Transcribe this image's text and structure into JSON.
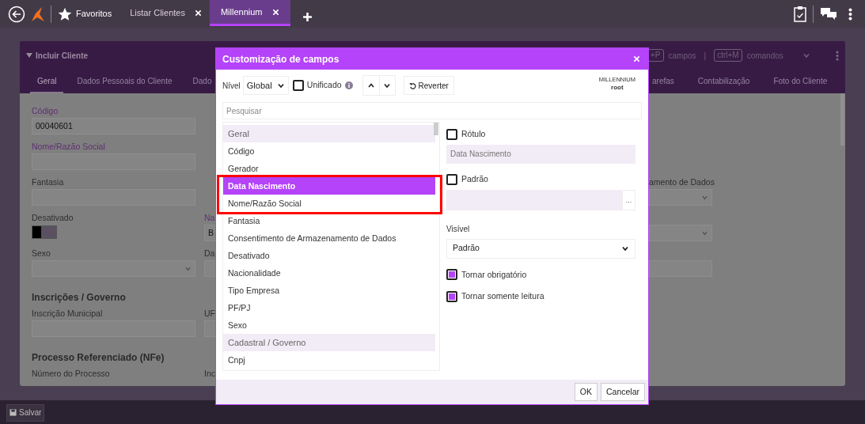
{
  "top_bar": {
    "favorites": "Favoritos",
    "tabs": [
      {
        "label": "Listar Clientes",
        "selected": false
      },
      {
        "label": "Millennium",
        "selected": true
      }
    ]
  },
  "form": {
    "title": "Incluir Cliente",
    "shortcuts": [
      {
        "key": "+P",
        "text": "campos"
      },
      {
        "key": "ctrl+M",
        "text": "comandos"
      }
    ],
    "separator": "|",
    "tabs": [
      {
        "label": "Geral",
        "selected": true
      },
      {
        "label": "Dados Pessoais do Cliente",
        "selected": false
      },
      {
        "label": "Dado",
        "selected": false
      }
    ],
    "tabs_right": [
      {
        "label": "arefas",
        "selected": false
      },
      {
        "label": "Contabilização",
        "selected": false
      },
      {
        "label": "Foto do Cliente",
        "selected": false
      }
    ],
    "rows": [
      {
        "left": {
          "kind": "field",
          "label": "Código",
          "required": true,
          "value": "00040601"
        }
      },
      {
        "left": {
          "kind": "field",
          "label": "Nome/Razão Social",
          "required": true
        }
      },
      {
        "left": {
          "kind": "field",
          "label": "Fantasia",
          "required": false
        },
        "right": {
          "kind": "select",
          "label": "amento de Dados",
          "required": false
        }
      },
      {
        "left": {
          "kind": "toggle",
          "label": "Desativado",
          "required": false,
          "on": false
        },
        "middle": {
          "kind": "field",
          "label": "Na",
          "required": true,
          "value": "B"
        },
        "right": {
          "kind": "select"
        }
      },
      {
        "left": {
          "kind": "select",
          "label": "Sexo",
          "required": false
        },
        "middle": {
          "kind": "field",
          "label": "Da",
          "required": false
        },
        "right": {
          "kind": "field"
        }
      },
      {
        "heading": "Inscrições / Governo"
      },
      {
        "left": {
          "kind": "field",
          "label": "Inscrição Municipal",
          "required": false
        },
        "middle": {
          "kind": "field",
          "label": "UF",
          "required": false
        }
      },
      {
        "heading": "Processo Referenciado (NFe)"
      },
      {
        "left": {
          "kind": "label",
          "label": "Número do Processo",
          "required": false
        },
        "middle": {
          "kind": "label",
          "label": "Inc",
          "required": false
        }
      }
    ]
  },
  "save_button": "Salvar",
  "dialog": {
    "title": "Customização de campos",
    "level_label": "Nível",
    "level_value": "Global",
    "unified": {
      "label": "Unificado",
      "checked": false
    },
    "revert": "Reverter",
    "system": "MILLENNIUM",
    "user": "root",
    "search_placeholder": "Pesquisar",
    "fields": [
      {
        "label": "Geral",
        "kind": "group",
        "selected": false,
        "highlighted": false
      },
      {
        "label": "Código",
        "kind": "item",
        "selected": false,
        "highlighted": false
      },
      {
        "label": "Gerador",
        "kind": "item",
        "selected": false,
        "highlighted": false
      },
      {
        "label": "Data Nascimento",
        "kind": "item",
        "selected": true,
        "highlighted": true
      },
      {
        "label": "Nome/Razão Social",
        "kind": "item",
        "selected": false,
        "highlighted": true
      },
      {
        "label": "Fantasia",
        "kind": "item",
        "selected": false,
        "highlighted": false
      },
      {
        "label": "Consentimento de Armazenamento de Dados",
        "kind": "item",
        "selected": false,
        "highlighted": false
      },
      {
        "label": "Desativado",
        "kind": "item",
        "selected": false,
        "highlighted": false
      },
      {
        "label": "Nacionalidade",
        "kind": "item",
        "selected": false,
        "highlighted": false
      },
      {
        "label": "Tipo Empresa",
        "kind": "item",
        "selected": false,
        "highlighted": false
      },
      {
        "label": "PF/PJ",
        "kind": "item",
        "selected": false,
        "highlighted": false
      },
      {
        "label": "Sexo",
        "kind": "item",
        "selected": false,
        "highlighted": false
      },
      {
        "label": "Cadastral / Governo",
        "kind": "group",
        "selected": false,
        "highlighted": false
      },
      {
        "label": "Cnpj",
        "kind": "item",
        "selected": false,
        "highlighted": false
      }
    ],
    "label_option": {
      "label": "Rótulo",
      "checked": false,
      "value": "Data Nascimento"
    },
    "default_option": {
      "label": "Padrão",
      "checked": false,
      "button": "..."
    },
    "visible": {
      "label": "Visível",
      "value": "Padrão"
    },
    "options": [
      {
        "label": "Tornar obrigatório",
        "checked": true
      },
      {
        "label": "Tornar somente leitura",
        "checked": true
      }
    ],
    "buttons": [
      "OK",
      "Cancelar"
    ]
  }
}
